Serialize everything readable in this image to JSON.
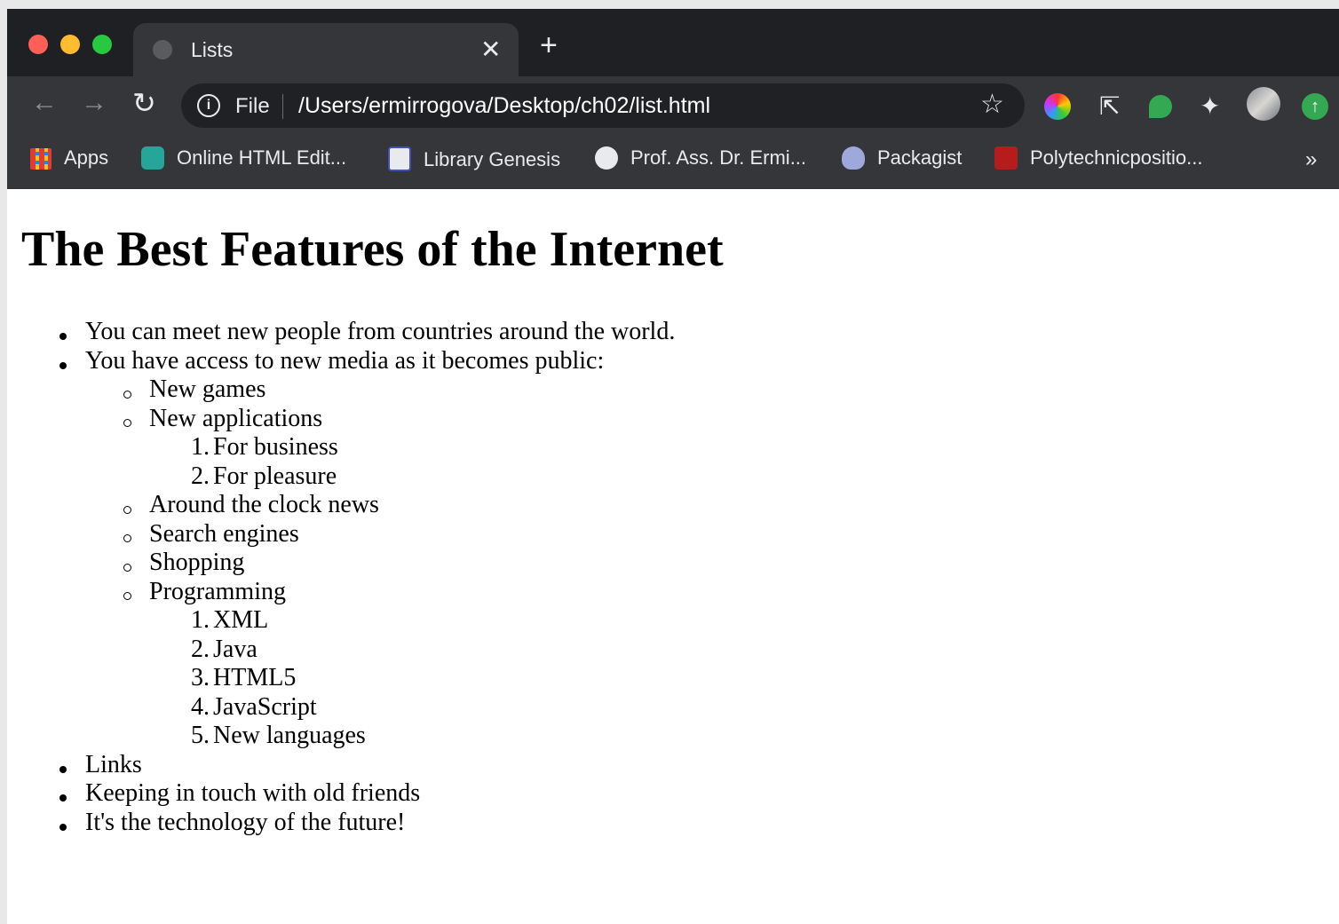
{
  "tab": {
    "title": "Lists",
    "close": "✕",
    "new_tab": "+"
  },
  "toolbar": {
    "back": "←",
    "forward": "→",
    "reload": "↻",
    "info": "i",
    "scheme_label": "File",
    "url": "/Users/ermirrogova/Desktop/ch02/list.html",
    "star": "☆"
  },
  "extensions": [
    "color-picker-icon",
    "cursor-icon",
    "chat-bubble-icon",
    "puzzle-icon",
    "avatar",
    "update-icon"
  ],
  "bookmarks": [
    {
      "label": "Apps",
      "icon": "apps-grid-icon"
    },
    {
      "label": "Online HTML Edit...",
      "icon": "html-editor-icon"
    },
    {
      "label": "Library Genesis",
      "icon": "book-icon"
    },
    {
      "label": "Prof. Ass. Dr. Ermi...",
      "icon": "globe-icon"
    },
    {
      "label": "Packagist",
      "icon": "packagist-icon"
    },
    {
      "label": "Polytechnicpositio...",
      "icon": "site-icon"
    }
  ],
  "bookmarks_more": "»",
  "page": {
    "title": "The Best Features of the Internet",
    "items": [
      "You can meet new people from countries around the world.",
      "You have access to new media as it becomes public:",
      "Links",
      "Keeping in touch with old friends",
      "It's the technology of the future!"
    ],
    "media": [
      "New games",
      "New applications",
      "Around the clock news",
      "Search engines",
      "Shopping",
      "Programming"
    ],
    "applications": [
      "For business",
      "For pleasure"
    ],
    "programming": [
      "XML",
      "Java",
      "HTML5",
      "JavaScript",
      "New languages"
    ],
    "markers": [
      "1.",
      "2.",
      "3.",
      "4.",
      "5."
    ]
  }
}
